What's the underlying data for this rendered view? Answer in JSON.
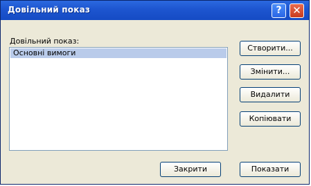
{
  "window": {
    "title": "Довільний показ"
  },
  "titlebar": {
    "help_label": "?",
    "close_label": "✕"
  },
  "list": {
    "label": "Довільний показ:",
    "items": [
      "Основні вимоги"
    ],
    "selected_index": 0
  },
  "buttons": {
    "create": "Створити...",
    "edit": "Змінити...",
    "delete": "Видалити",
    "copy": "Копіювати",
    "close": "Закрити",
    "show": "Показати"
  }
}
